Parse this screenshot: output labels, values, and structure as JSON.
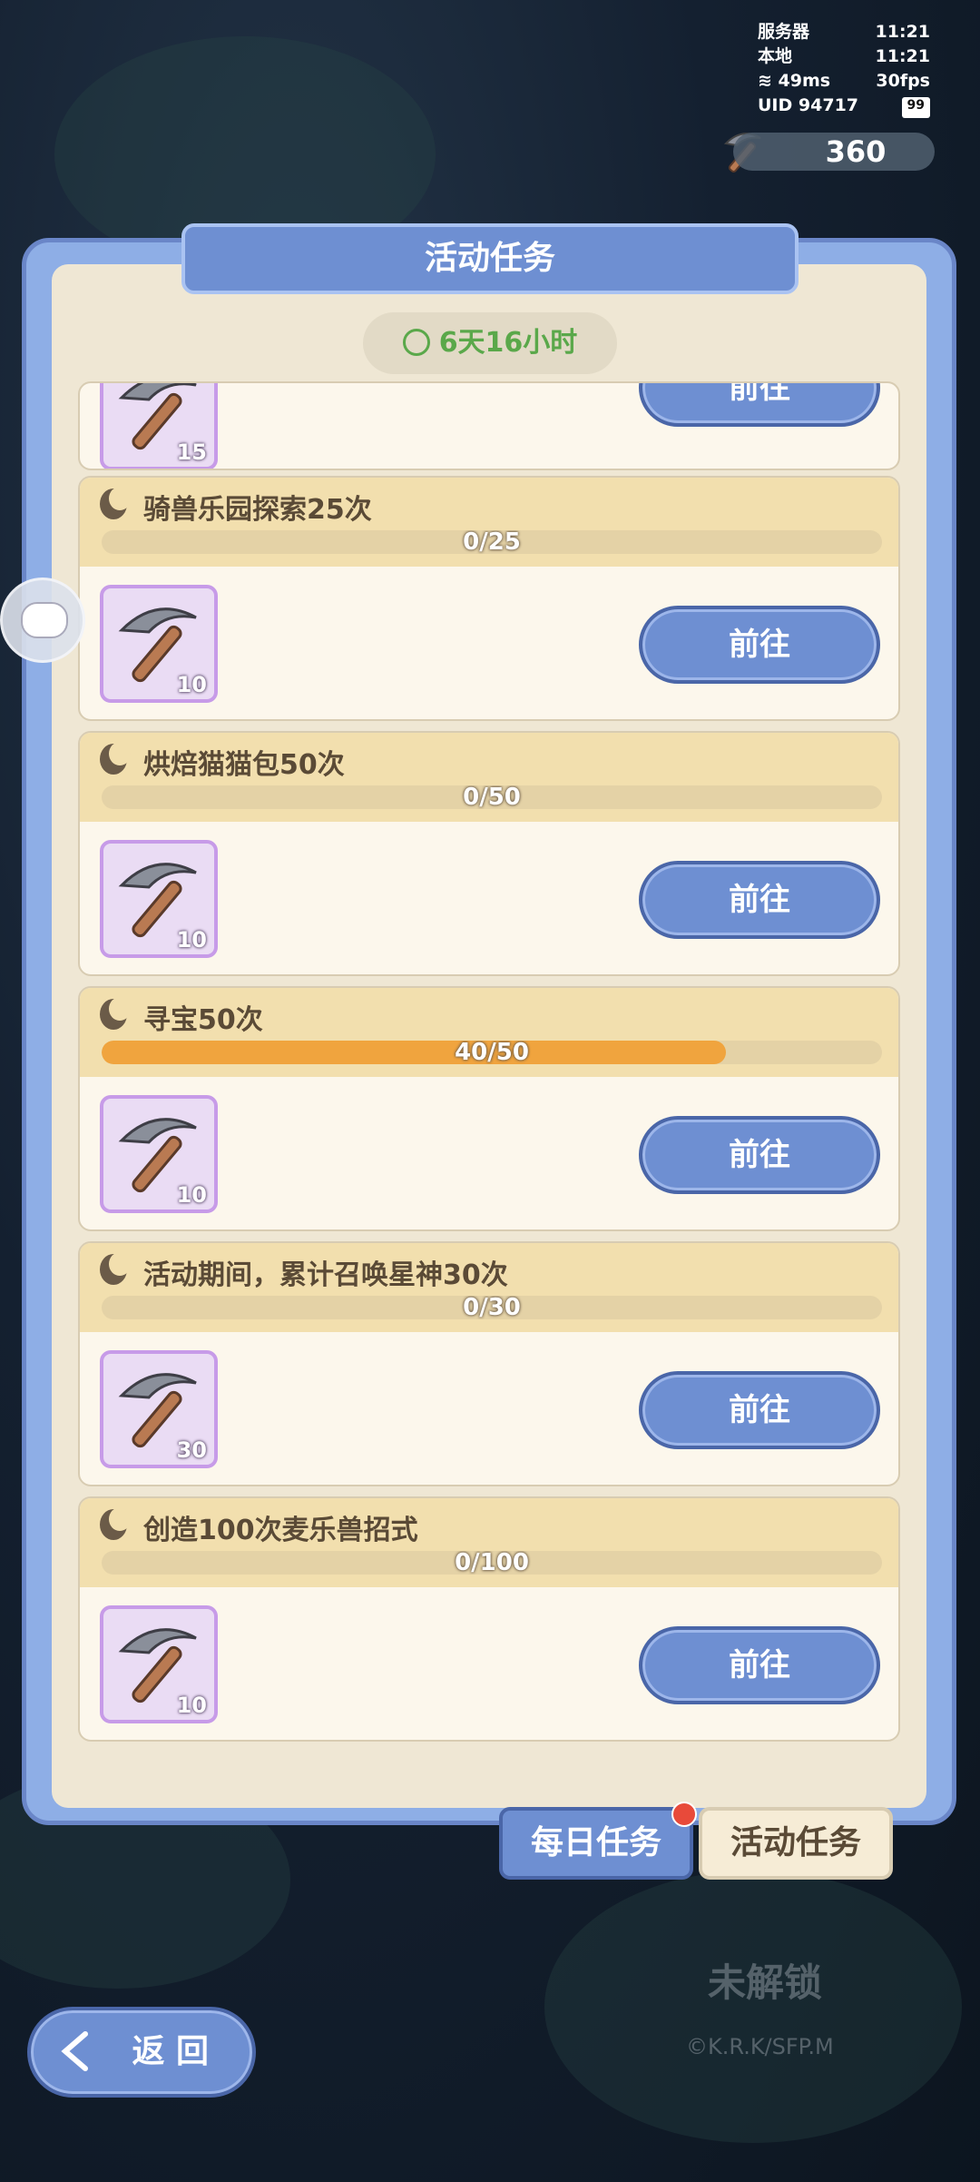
{
  "status": {
    "server_label": "服务器",
    "server_time": "11:21",
    "local_label": "本地",
    "local_time": "11:21",
    "ping": "49ms",
    "fps": "30fps",
    "uid_label": "UID",
    "uid": "94717",
    "battery": "99"
  },
  "currency": {
    "icon": "pickaxe-icon",
    "amount": "360"
  },
  "panel": {
    "title": "活动任务",
    "timer": "6天16小时"
  },
  "partial_task": {
    "reward_count": "15",
    "button": "前往"
  },
  "tasks": [
    {
      "title": "骑兽乐园探索25次",
      "progress_text": "0/25",
      "progress": 0,
      "reward_icon": "pickaxe-icon",
      "reward_count": "10",
      "button": "前往"
    },
    {
      "title": "烘焙猫猫包50次",
      "progress_text": "0/50",
      "progress": 0,
      "reward_icon": "pickaxe-icon",
      "reward_count": "10",
      "button": "前往"
    },
    {
      "title": "寻宝50次",
      "progress_text": "40/50",
      "progress": 0.8,
      "reward_icon": "pickaxe-icon",
      "reward_count": "10",
      "button": "前往"
    },
    {
      "title": "活动期间，累计召唤星神30次",
      "progress_text": "0/30",
      "progress": 0,
      "reward_icon": "pickaxe-icon",
      "reward_count": "30",
      "button": "前往"
    },
    {
      "title": "创造100次麦乐兽招式",
      "progress_text": "0/100",
      "progress": 0,
      "reward_icon": "pickaxe-icon",
      "reward_count": "10",
      "button": "前往"
    }
  ],
  "tabs": {
    "daily": "每日任务",
    "activity": "活动任务"
  },
  "locked_text": "未解锁",
  "copyright": "©K.R.K/SFP.M",
  "back_button": "返 回",
  "colors": {
    "accent_blue": "#6e8fd2",
    "progress_orange": "#f0a43e",
    "timer_green": "#5aa84a"
  }
}
